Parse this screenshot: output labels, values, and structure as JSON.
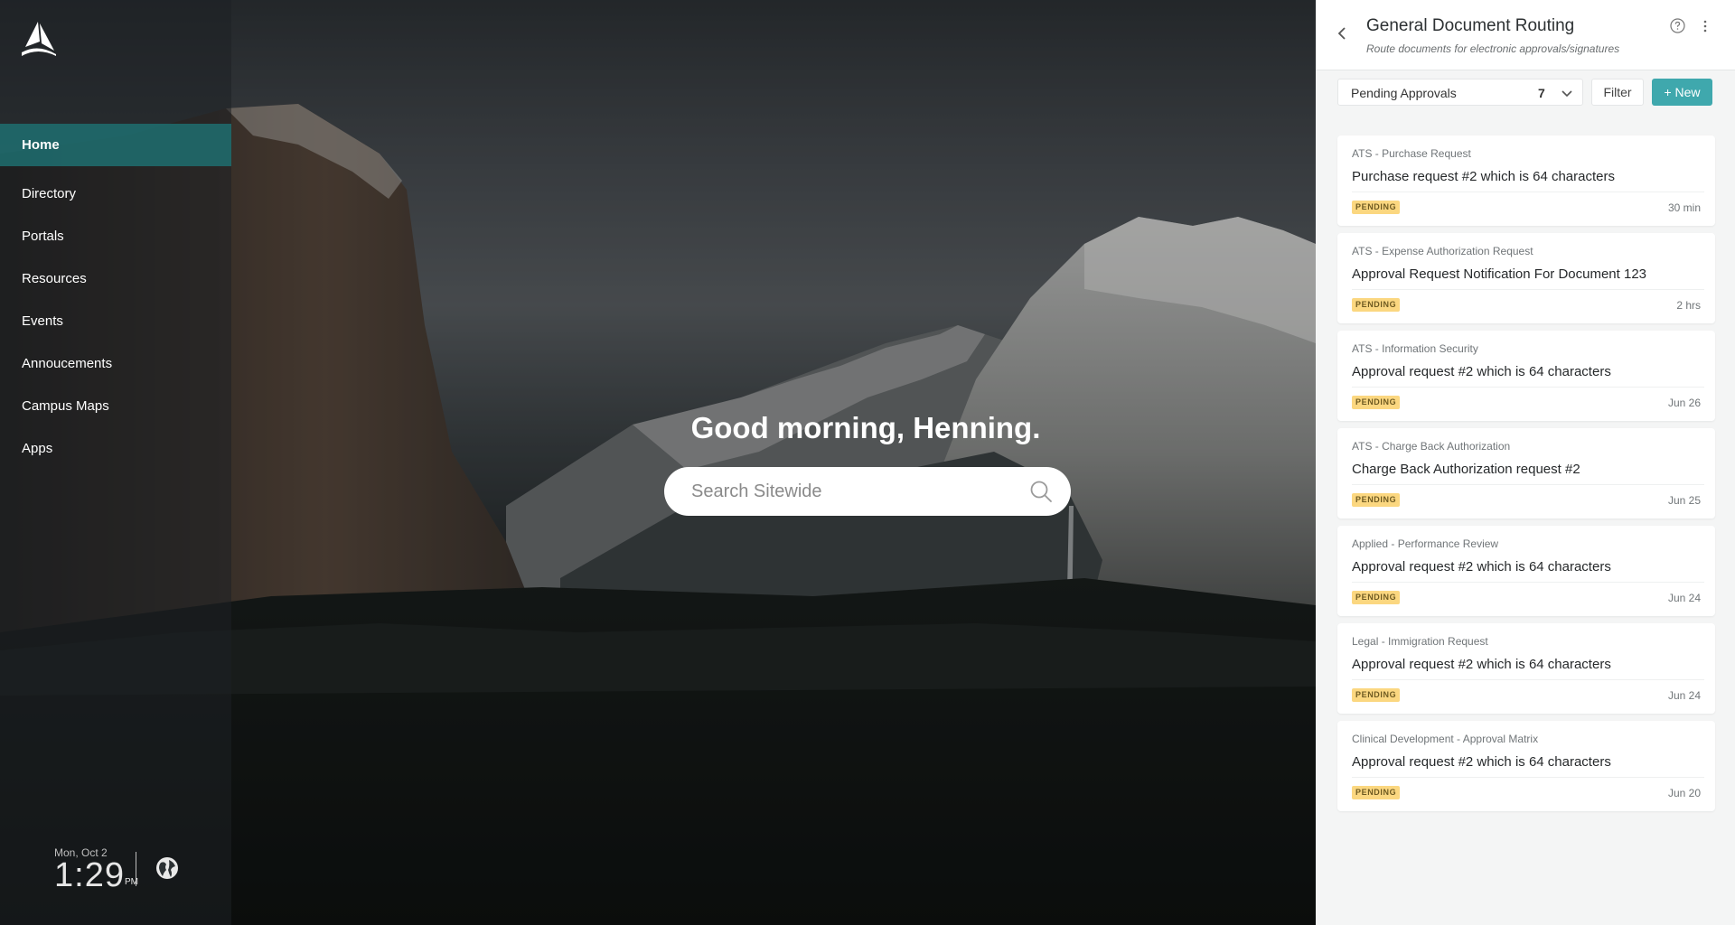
{
  "nav": {
    "items": [
      {
        "label": "Home",
        "active": true
      },
      {
        "label": "Directory"
      },
      {
        "label": "Portals"
      },
      {
        "label": "Resources"
      },
      {
        "label": "Events"
      },
      {
        "label": "Annoucements"
      },
      {
        "label": "Campus Maps"
      },
      {
        "label": "Apps"
      }
    ]
  },
  "clock": {
    "date": "Mon, Oct 2",
    "time": "1:29",
    "ampm": "PM"
  },
  "hero": {
    "greeting": "Good morning, Henning.",
    "search_placeholder": "Search Sitewide"
  },
  "panel": {
    "title": "General Document Routing",
    "subtitle": "Route documents for electronic approvals/signatures",
    "view_label": "Pending Approvals",
    "view_count": "7",
    "filter_label": "Filter",
    "new_label": "+ New",
    "accent": "#3fa8ad",
    "cards": [
      {
        "category": "ATS - Purchase Request",
        "title": "Purchase request #2 which is 64 characters",
        "status": "PENDING",
        "time": "30 min"
      },
      {
        "category": "ATS - Expense Authorization Request",
        "title": "Approval Request Notification For Document 123",
        "status": "PENDING",
        "time": "2 hrs"
      },
      {
        "category": "ATS - Information Security",
        "title": "Approval request #2 which is 64 characters",
        "status": "PENDING",
        "time": "Jun 26"
      },
      {
        "category": "ATS - Charge Back Authorization",
        "title": "Charge Back Authorization request #2",
        "status": "PENDING",
        "time": "Jun 25"
      },
      {
        "category": "Applied - Performance Review",
        "title": "Approval request #2 which is 64 characters",
        "status": "PENDING",
        "time": "Jun 24"
      },
      {
        "category": "Legal - Immigration Request",
        "title": "Approval request #2 which is 64 characters",
        "status": "PENDING",
        "time": "Jun 24"
      },
      {
        "category": "Clinical Development - Approval Matrix",
        "title": "Approval request #2 which is 64 characters",
        "status": "PENDING",
        "time": "Jun 20"
      }
    ]
  }
}
